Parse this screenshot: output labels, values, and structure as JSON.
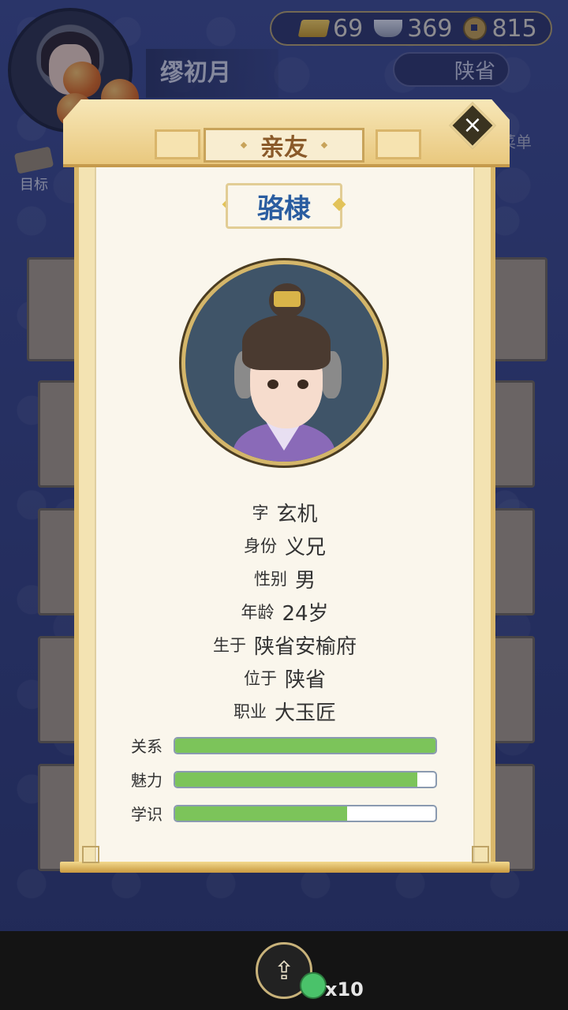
{
  "hud": {
    "player_name": "缪初月",
    "gold": "69",
    "silver": "369",
    "coins": "815",
    "province": "陕省",
    "menu_label": "菜单",
    "goal_label": "目标"
  },
  "modal": {
    "title": "亲友",
    "person_name": "骆棣",
    "info": [
      {
        "key": "字",
        "value": "玄机"
      },
      {
        "key": "身份",
        "value": "义兄"
      },
      {
        "key": "性别",
        "value": "男"
      },
      {
        "key": "年龄",
        "value": "24岁"
      },
      {
        "key": "生于",
        "value": "陕省安榆府"
      },
      {
        "key": "位于",
        "value": "陕省"
      },
      {
        "key": "职业",
        "value": "大玉匠"
      }
    ],
    "stats": [
      {
        "label": "关系",
        "level": 1.0
      },
      {
        "label": "魅力",
        "level": 0.93
      },
      {
        "label": "学识",
        "level": 0.66
      }
    ]
  },
  "footer": {
    "bonus_count": "x10"
  },
  "icons": {
    "close": "close-icon",
    "share": "share-icon",
    "gold": "gold-ingot-icon",
    "silver": "silver-ingot-icon",
    "coin": "copper-coin-icon"
  },
  "colors": {
    "stat_fill": "#7cc45a",
    "name": "#2a5da0",
    "title": "#8a5a2a"
  }
}
